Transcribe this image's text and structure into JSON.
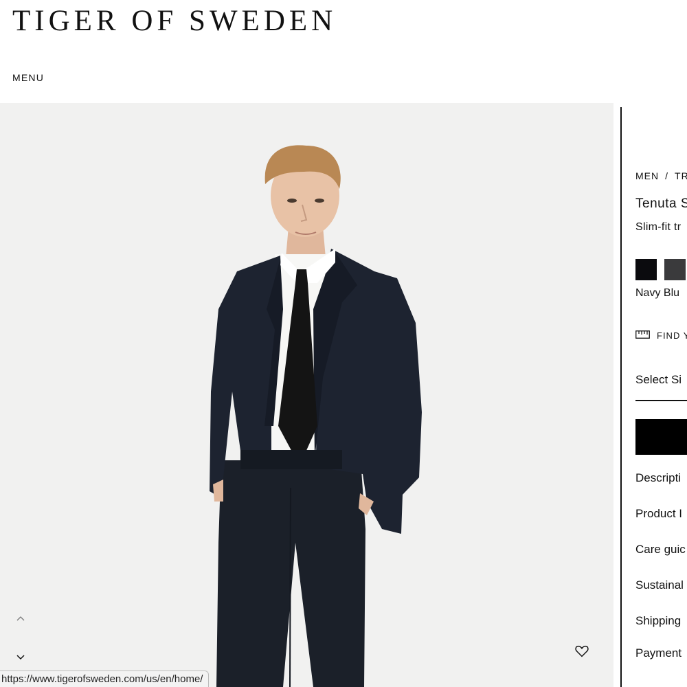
{
  "header": {
    "logo": "TIGER OF SWEDEN",
    "menu_label": "MENU"
  },
  "gallery": {
    "scroll_up_icon": "chevron-up-icon",
    "scroll_down_icon": "chevron-down-icon",
    "wishlist_icon": "heart-icon"
  },
  "status_bar": {
    "url": "https://www.tigerofsweden.com/us/en/home/"
  },
  "product": {
    "breadcrumb": [
      "MEN",
      "TR"
    ],
    "breadcrumb_separator": "/",
    "name": "Tenuta S",
    "subtitle": "Slim-fit tr",
    "swatches": [
      {
        "color": "#0b0b0e"
      },
      {
        "color": "#3a3a3c"
      }
    ],
    "selected_color": "Navy Blu",
    "find_fit_label": "FIND Y",
    "find_fit_icon": "ruler-icon",
    "select_size_label": "Select Si",
    "accordion": [
      "Descripti",
      "Product I",
      "Care guic",
      "Sustainal",
      "Shipping",
      "Payment"
    ]
  },
  "colors": {
    "background": "#ffffff",
    "photo_background": "#f1f1f0",
    "text": "#111111",
    "button": "#000000"
  }
}
